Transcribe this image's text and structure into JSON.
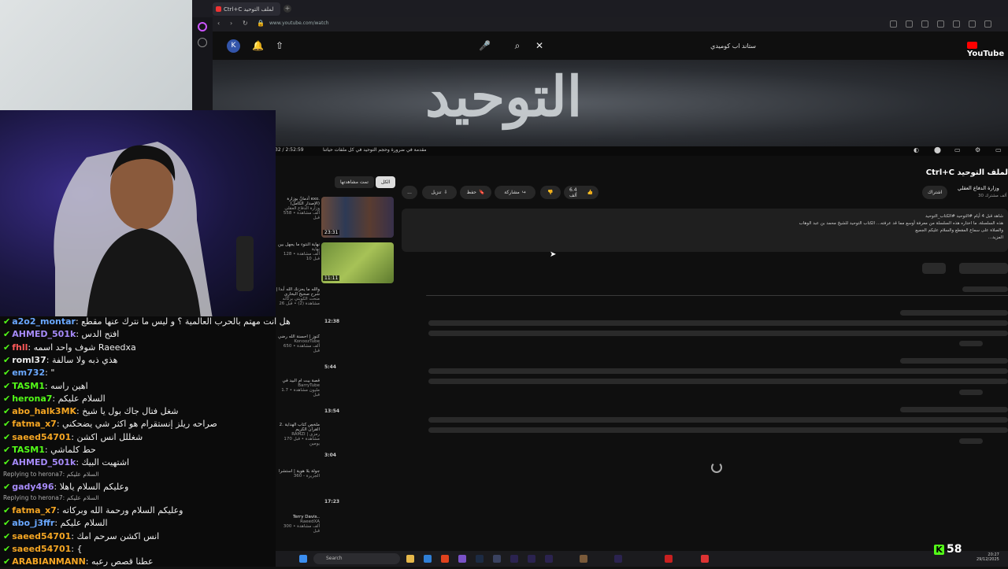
{
  "browser": {
    "tab_title": "Ctrl+C لملف التوحيد",
    "url": "www.youtube.com/watch"
  },
  "youtube": {
    "avatar_letter": "K",
    "search_value": "ستاند اب كوميدي",
    "logo_text": "YouTube",
    "video_overlay_text": "التوحيد",
    "time_display": "32 / 2:52:59",
    "chapter": "مقدمة في ضرورة وحجم التوحيد في كل ملفات حياتنا",
    "title": "Ctrl+C لملف التوحيد",
    "channel": "وزارة الدفاع العقلي",
    "subscribers": "30 ألف مشترك",
    "subscribe": "اشتراك",
    "like_count": "6.4 ألف",
    "share": "مشاركة",
    "save": "حفظ",
    "download": "تنزيل",
    "more": "...",
    "chip_all": "الكل",
    "chip_watched": "تمت مشاهدتها",
    "description_lines": [
      "شاهد قبل 4 أيام  #التوحيد #الكتاب_التوحيد",
      "هذه السلسلة، ما اختاره هذه السلسلة من معرفة أوسع مما قد عرفته... الكتاب التوحيد للشيخ محمد بن عبد الوهاب",
      "والصلاة على سماع المقطع والسلام عليكم الجميع",
      "...المزيد"
    ]
  },
  "recommendations": [
    {
      "title": "آدمانٌ بوزارة exo. (الإصدار الكامل)",
      "channel": "وزارة الدفاع العقلي",
      "meta": "558 ألف مشاهدة • قبل",
      "duration": "23:31"
    },
    {
      "title": "نهاية النتوء ما يجهل بين",
      "channel": "نهاية",
      "meta": "128 ألف مشاهدة • قبل 10",
      "duration": "11:11"
    },
    {
      "title": "والله ما يحزنك الله أبدا | شرح صحيح البخاري",
      "channel": "منحت الكويتي بركاته",
      "meta": "مشاهدة (2) • قبل 26",
      "duration": "12:38"
    },
    {
      "title": "كنوز | احسنة الله رضي",
      "channel": "KonoozTube",
      "meta": "650 ألف مشاهدة • قبل",
      "duration": "5:44"
    },
    {
      "title": "قصة بيت ام البيد في",
      "channel": "BarryTube",
      "meta": "1.7 مليون مشاهدة • قبل",
      "duration": "13:54"
    },
    {
      "title": "2. ملخص كتاب الهداية القرآن الكريم",
      "channel": "RAMZI | رمزي",
      "meta": "170 مشاهدة • قبل يومين",
      "duration": "3:04"
    },
    {
      "title": "جولة بلا هوية | استشرا",
      "channel": "360 - الجزيرة",
      "meta": "",
      "duration": "17:23"
    },
    {
      "title": "Terry Davis..",
      "channel": "RaeedXA",
      "meta": "300 ألف مشاهدة • قبل",
      "duration": ""
    }
  ],
  "chat": [
    {
      "user": "a2o2_montar",
      "text": "هل انت مهتم بالحرب العالمية ؟ و ليس ما نترك عنها مقطع",
      "color": "#6aa8ff",
      "reply": ""
    },
    {
      "user": "AHMED_501k",
      "text": "افتح الدس",
      "color": "#a78bfa",
      "reply": ""
    },
    {
      "user": "fhll",
      "text": "شوف واحد اسمه Raeedxa",
      "color": "#ff5a5a",
      "reply": ""
    },
    {
      "user": "roml37",
      "text": "هذي ذبه ولا سالفة",
      "color": "#e8e8e8",
      "reply": ""
    },
    {
      "user": "em732",
      "text": "\"",
      "color": "#6aa8ff",
      "reply": ""
    },
    {
      "user": "TASM1",
      "text": "اهين راسه",
      "color": "#53fc18",
      "reply": ""
    },
    {
      "user": "herona7",
      "text": "السلام عليكم",
      "color": "#53fc18",
      "reply": ""
    },
    {
      "user": "abo_halk3MK",
      "text": "شغل فتال جاك بول يا شيخ",
      "color": "#f5a623",
      "reply": ""
    },
    {
      "user": "fatma_x7",
      "text": "صراحه ريلز إنستقرام هو اكثر شي يضحكني",
      "color": "#f5a623",
      "reply": ""
    },
    {
      "user": "saeed54701",
      "text": "شغللل انس اكشن",
      "color": "#f5a623",
      "reply": ""
    },
    {
      "user": "TASM1",
      "text": "حط كلماشي",
      "color": "#53fc18",
      "reply": ""
    },
    {
      "user": "AHMED_501k",
      "text": "اشتهيت البيك",
      "color": "#a78bfa",
      "reply": ""
    },
    {
      "user": "gady496",
      "text": "وعليكم السلام ياهلا",
      "color": "#a78bfa",
      "reply": "Replying to herona7: السلام عليكم"
    },
    {
      "user": "fatma_x7",
      "text": "وعليكم السلام ورحمة الله وبركاته",
      "color": "#f5a623",
      "reply": "Replying to herona7: السلام عليكم"
    },
    {
      "user": "abo_j3ffr",
      "text": "السلام عليكم",
      "color": "#6aa8ff",
      "reply": ""
    },
    {
      "user": "saeed54701",
      "text": "انس اكشن سرحم امك",
      "color": "#f5a623",
      "reply": ""
    },
    {
      "user": "saeed54701",
      "text": "{",
      "color": "#f5a623",
      "reply": ""
    },
    {
      "user": "ARABIANMANN",
      "text": "عطنا قصص رعبه",
      "color": "#f5a623",
      "reply": ""
    }
  ],
  "taskbar": {
    "search_label": "Search",
    "time": "20:27",
    "date": "29/12/2025"
  },
  "kick": {
    "viewer_count": "58"
  }
}
